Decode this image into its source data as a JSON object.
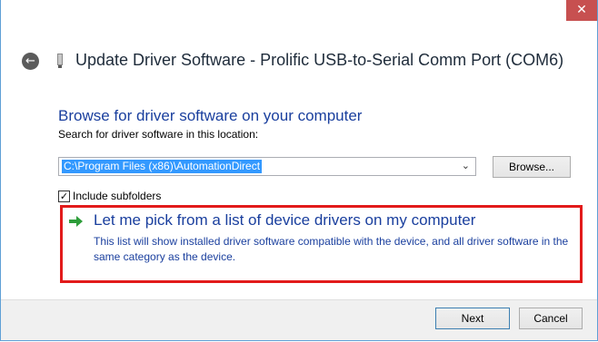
{
  "window": {
    "title": "Update Driver Software - Prolific USB-to-Serial Comm Port (COM6)",
    "close_glyph": "✕",
    "back_glyph": "←"
  },
  "content": {
    "heading": "Browse for driver software on your computer",
    "search_label": "Search for driver software in this location:",
    "path_value": "C:\\Program Files (x86)\\AutomationDirect",
    "dropdown_glyph": "⌄",
    "browse_label": "Browse...",
    "include_subfolders_label": "Include subfolders",
    "include_subfolders_checked": true,
    "check_glyph": "✓",
    "pick_title": "Let me pick from a list of device drivers on my computer",
    "pick_description": "This list will show installed driver software compatible with the device, and all driver software in the same category as the device."
  },
  "footer": {
    "next_label": "Next",
    "cancel_label": "Cancel"
  },
  "colors": {
    "accent_blue": "#1a3f9e",
    "highlight_red": "#e21b1b",
    "selection_blue": "#3399ff",
    "arrow_green": "#2e9d3a",
    "close_red": "#c75050"
  }
}
